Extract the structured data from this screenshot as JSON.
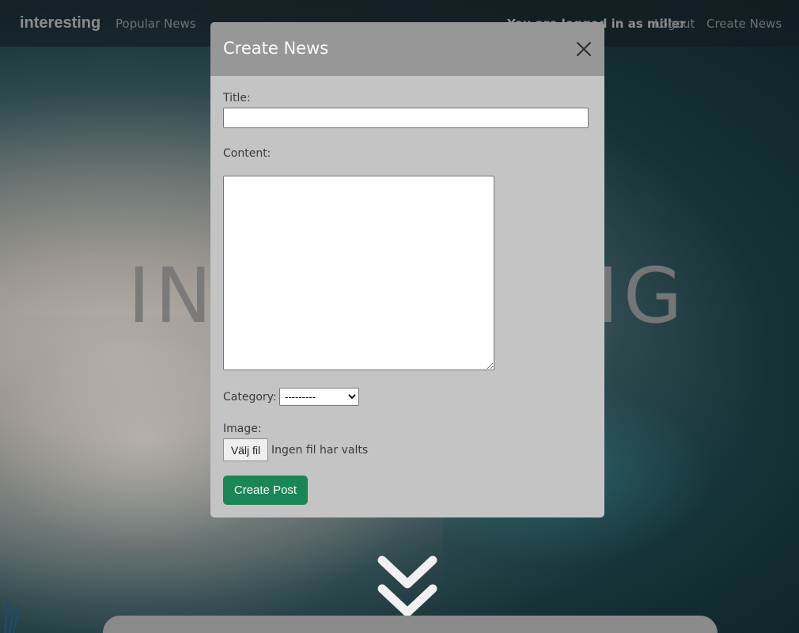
{
  "navbar": {
    "brand": "interesting",
    "popular_news": "Popular News",
    "status_text": "You are logged in as miller",
    "logout": "Logout",
    "create_news": "Create News"
  },
  "hero": {
    "title": "INTERESTING"
  },
  "modal": {
    "title": "Create News",
    "close_icon": "close-icon",
    "title_label": "Title:",
    "title_value": "",
    "content_label": "Content:",
    "content_value": "",
    "category_label": "Category:",
    "category_selected": "---------",
    "image_label": "Image:",
    "file_button_label": "Välj fil",
    "file_status": "Ingen fil har valts",
    "submit_label": "Create Post"
  },
  "colors": {
    "submit_button": "#198754",
    "modal_header": "#979797",
    "modal_body": "#c4c4c4"
  },
  "icons": {
    "scroll_down": "double-chevron-down-icon"
  }
}
